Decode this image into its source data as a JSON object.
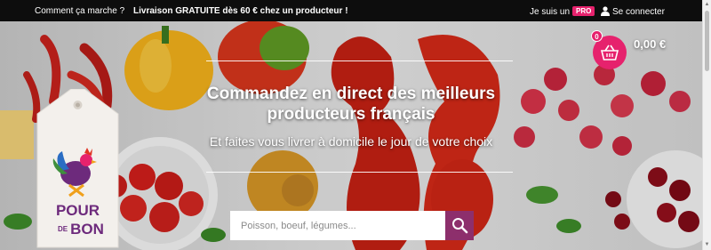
{
  "topbar": {
    "how_it_works": "Comment ça marche ?",
    "free_shipping": "Livraison GRATUITE dès 60 € chez un producteur !",
    "producer_prefix": "Je suis un",
    "pro_badge": "PRO",
    "login": "Se connecter"
  },
  "hero": {
    "title": "Commandez en direct des meilleurs producteurs français",
    "subtitle": "Et faites vous livrer à domicile le jour de votre choix"
  },
  "search": {
    "placeholder": "Poisson, boeuf, légumes..."
  },
  "cart": {
    "count": "0",
    "total": "0,00 €"
  },
  "logo": {
    "line1": "POUR",
    "line2": "DE",
    "line3": "BON"
  },
  "colors": {
    "brand_pink": "#e6226d",
    "search_button": "#8d2f6c",
    "topbar_bg": "#0d0d0d"
  },
  "icons": {
    "user": "user-icon",
    "basket": "basket-icon",
    "search": "search-icon",
    "rooster": "rooster-icon"
  }
}
